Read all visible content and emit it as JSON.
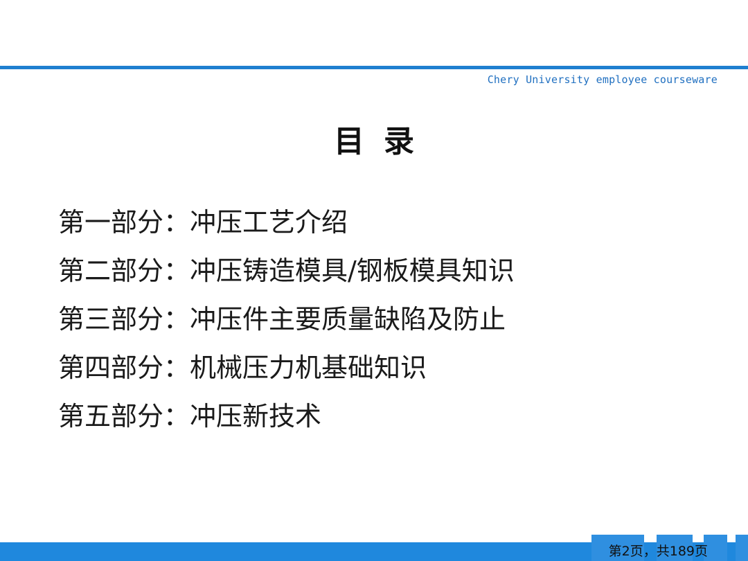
{
  "header": {
    "courseware_label": "Chery University employee courseware"
  },
  "title": "目录",
  "toc": {
    "items": [
      "第一部分：冲压工艺介绍",
      "第二部分：冲压铸造模具/钢板模具知识",
      "第三部分：冲压件主要质量缺陷及防止",
      "第四部分：机械压力机基础知识",
      "第五部分：冲压新技术"
    ]
  },
  "footer": {
    "page_label": "第2页，共189页"
  },
  "colors": {
    "accent_blue": "#1f7fd0",
    "footer_blue": "#1f88dd"
  }
}
